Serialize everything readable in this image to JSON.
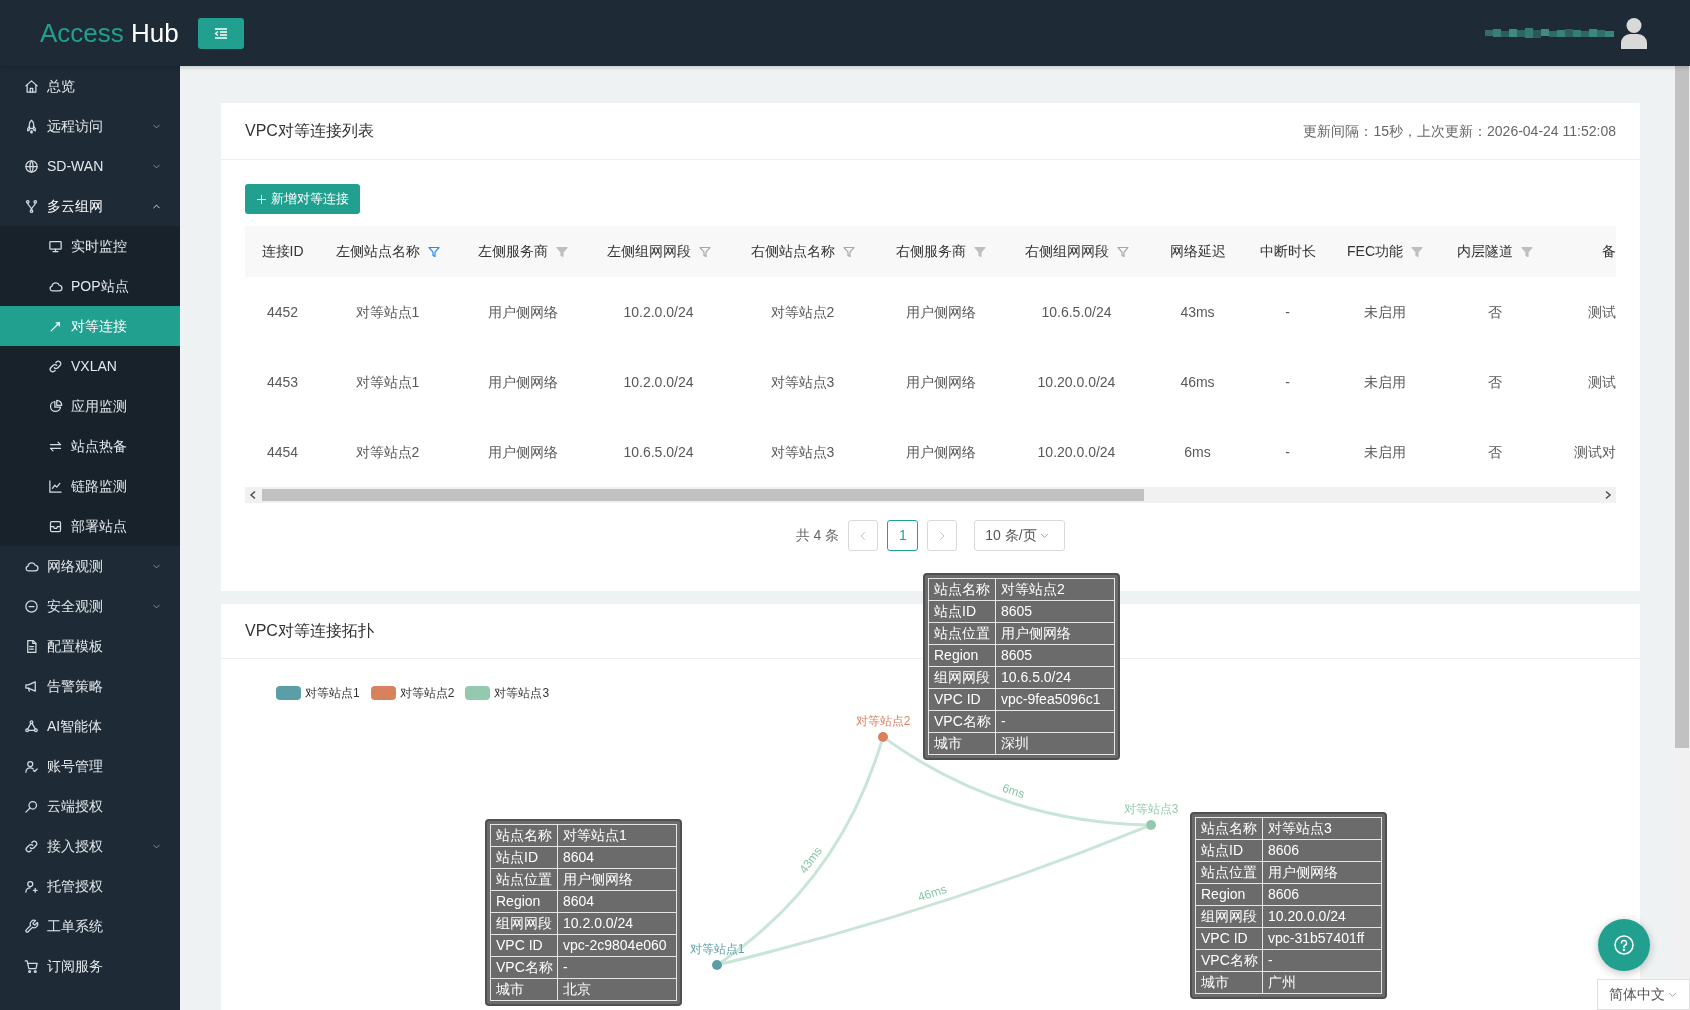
{
  "header": {
    "logo_primary": "Access",
    "logo_secondary": "Hub"
  },
  "sidebar": {
    "items": [
      {
        "label": "总览",
        "expandable": false,
        "expanded": false,
        "selected": false
      },
      {
        "label": "远程访问",
        "expandable": true,
        "expanded": false,
        "selected": false
      },
      {
        "label": "SD-WAN",
        "expandable": true,
        "expanded": false,
        "selected": false
      },
      {
        "label": "多云组网",
        "expandable": true,
        "expanded": true,
        "selected": false,
        "children": [
          {
            "label": "实时监控",
            "selected": false
          },
          {
            "label": "POP站点",
            "selected": false
          },
          {
            "label": "对等连接",
            "selected": true
          },
          {
            "label": "VXLAN",
            "selected": false
          },
          {
            "label": "应用监测",
            "selected": false
          },
          {
            "label": "站点热备",
            "selected": false
          },
          {
            "label": "链路监测",
            "selected": false
          },
          {
            "label": "部署站点",
            "selected": false
          }
        ]
      },
      {
        "label": "网络观测",
        "expandable": true,
        "expanded": false,
        "selected": false
      },
      {
        "label": "安全观测",
        "expandable": true,
        "expanded": false,
        "selected": false
      },
      {
        "label": "配置模板",
        "expandable": false,
        "expanded": false,
        "selected": false
      },
      {
        "label": "告警策略",
        "expandable": false,
        "expanded": false,
        "selected": false
      },
      {
        "label": "AI智能体",
        "expandable": false,
        "expanded": false,
        "selected": false
      },
      {
        "label": "账号管理",
        "expandable": false,
        "expanded": false,
        "selected": false
      },
      {
        "label": "云端授权",
        "expandable": false,
        "expanded": false,
        "selected": false
      },
      {
        "label": "接入授权",
        "expandable": true,
        "expanded": false,
        "selected": false
      },
      {
        "label": "托管授权",
        "expandable": false,
        "expanded": false,
        "selected": false
      },
      {
        "label": "工单系统",
        "expandable": false,
        "expanded": false,
        "selected": false
      },
      {
        "label": "订阅服务",
        "expandable": false,
        "expanded": false,
        "selected": false
      }
    ]
  },
  "list_panel": {
    "title": "VPC对等连接列表",
    "update_info": "更新间隔：15秒，上次更新：2026-04-24 11:52:08",
    "add_button": "新增对等连接",
    "table": {
      "columns": [
        {
          "label": "连接ID"
        },
        {
          "label": "左侧站点名称",
          "filter": {
            "kind": "outline",
            "active": true
          }
        },
        {
          "label": "左侧服务商",
          "filter": {
            "kind": "solid",
            "active": false
          }
        },
        {
          "label": "左侧组网网段",
          "filter": {
            "kind": "outline",
            "active": false
          }
        },
        {
          "label": "右侧站点名称",
          "filter": {
            "kind": "outline",
            "active": false
          }
        },
        {
          "label": "右侧服务商",
          "filter": {
            "kind": "solid",
            "active": false
          }
        },
        {
          "label": "右侧组网网段",
          "filter": {
            "kind": "outline",
            "active": false
          }
        },
        {
          "label": "网络延迟"
        },
        {
          "label": "中断时长"
        },
        {
          "label": "FEC功能",
          "filter": {
            "kind": "solid",
            "active": false
          }
        },
        {
          "label": "内层隧道",
          "filter": {
            "kind": "solid",
            "active": false
          }
        },
        {
          "label": "备"
        }
      ],
      "rows": [
        {
          "cells": [
            "4452",
            "对等站点1",
            "用户侧网络",
            "10.2.0.0/24",
            "对等站点2",
            "用户侧网络",
            "10.6.5.0/24",
            "43ms",
            "-",
            "未启用",
            "否",
            "测试"
          ]
        },
        {
          "cells": [
            "4453",
            "对等站点1",
            "用户侧网络",
            "10.2.0.0/24",
            "对等站点3",
            "用户侧网络",
            "10.20.0.0/24",
            "46ms",
            "-",
            "未启用",
            "否",
            "测试"
          ]
        },
        {
          "cells": [
            "4454",
            "对等站点2",
            "用户侧网络",
            "10.6.5.0/24",
            "对等站点3",
            "用户侧网络",
            "10.20.0.0/24",
            "6ms",
            "-",
            "未启用",
            "否",
            "测试对"
          ]
        }
      ]
    },
    "pagination": {
      "total": "共 4 条",
      "prev_disabled": true,
      "next_disabled": true,
      "pages": [
        {
          "label": "1",
          "selected": true
        }
      ],
      "page_size": "10 条/页"
    }
  },
  "topology_panel": {
    "title": "VPC对等连接拓扑",
    "legend": [
      {
        "label": "对等站点1",
        "color": "#5b9ea8"
      },
      {
        "label": "对等站点2",
        "color": "#d9805f"
      },
      {
        "label": "对等站点3",
        "color": "#93c9ae"
      }
    ],
    "nodes": [
      {
        "label": "对等站点1",
        "color": "#5b9ea8",
        "tooltip": [
          {
            "key": "站点名称",
            "value": "对等站点1"
          },
          {
            "key": "站点ID",
            "value": "8604"
          },
          {
            "key": "站点位置",
            "value": "用户侧网络"
          },
          {
            "key": "Region",
            "value": "8604"
          },
          {
            "key": "组网网段",
            "value": "10.2.0.0/24"
          },
          {
            "key": "VPC ID",
            "value": "vpc-2c9804e060"
          },
          {
            "key": "VPC名称",
            "value": "-"
          },
          {
            "key": "城市",
            "value": "北京"
          }
        ]
      },
      {
        "label": "对等站点2",
        "color": "#d9805f",
        "tooltip": [
          {
            "key": "站点名称",
            "value": "对等站点2"
          },
          {
            "key": "站点ID",
            "value": "8605"
          },
          {
            "key": "站点位置",
            "value": "用户侧网络"
          },
          {
            "key": "Region",
            "value": "8605"
          },
          {
            "key": "组网网段",
            "value": "10.6.5.0/24"
          },
          {
            "key": "VPC ID",
            "value": "vpc-9fea5096c1"
          },
          {
            "key": "VPC名称",
            "value": "-"
          },
          {
            "key": "城市",
            "value": "深圳"
          }
        ]
      },
      {
        "label": "对等站点3",
        "color": "#93c9ae",
        "tooltip": [
          {
            "key": "站点名称",
            "value": "对等站点3"
          },
          {
            "key": "站点ID",
            "value": "8606"
          },
          {
            "key": "站点位置",
            "value": "用户侧网络"
          },
          {
            "key": "Region",
            "value": "8606"
          },
          {
            "key": "组网网段",
            "value": "10.20.0.0/24"
          },
          {
            "key": "VPC ID",
            "value": "vpc-31b57401ff"
          },
          {
            "key": "VPC名称",
            "value": "-"
          },
          {
            "key": "城市",
            "value": "广州"
          }
        ]
      }
    ],
    "edges": [
      {
        "label": "43ms"
      },
      {
        "label": "6ms"
      },
      {
        "label": "46ms"
      }
    ]
  },
  "language_selector": {
    "value": "简体中文"
  }
}
